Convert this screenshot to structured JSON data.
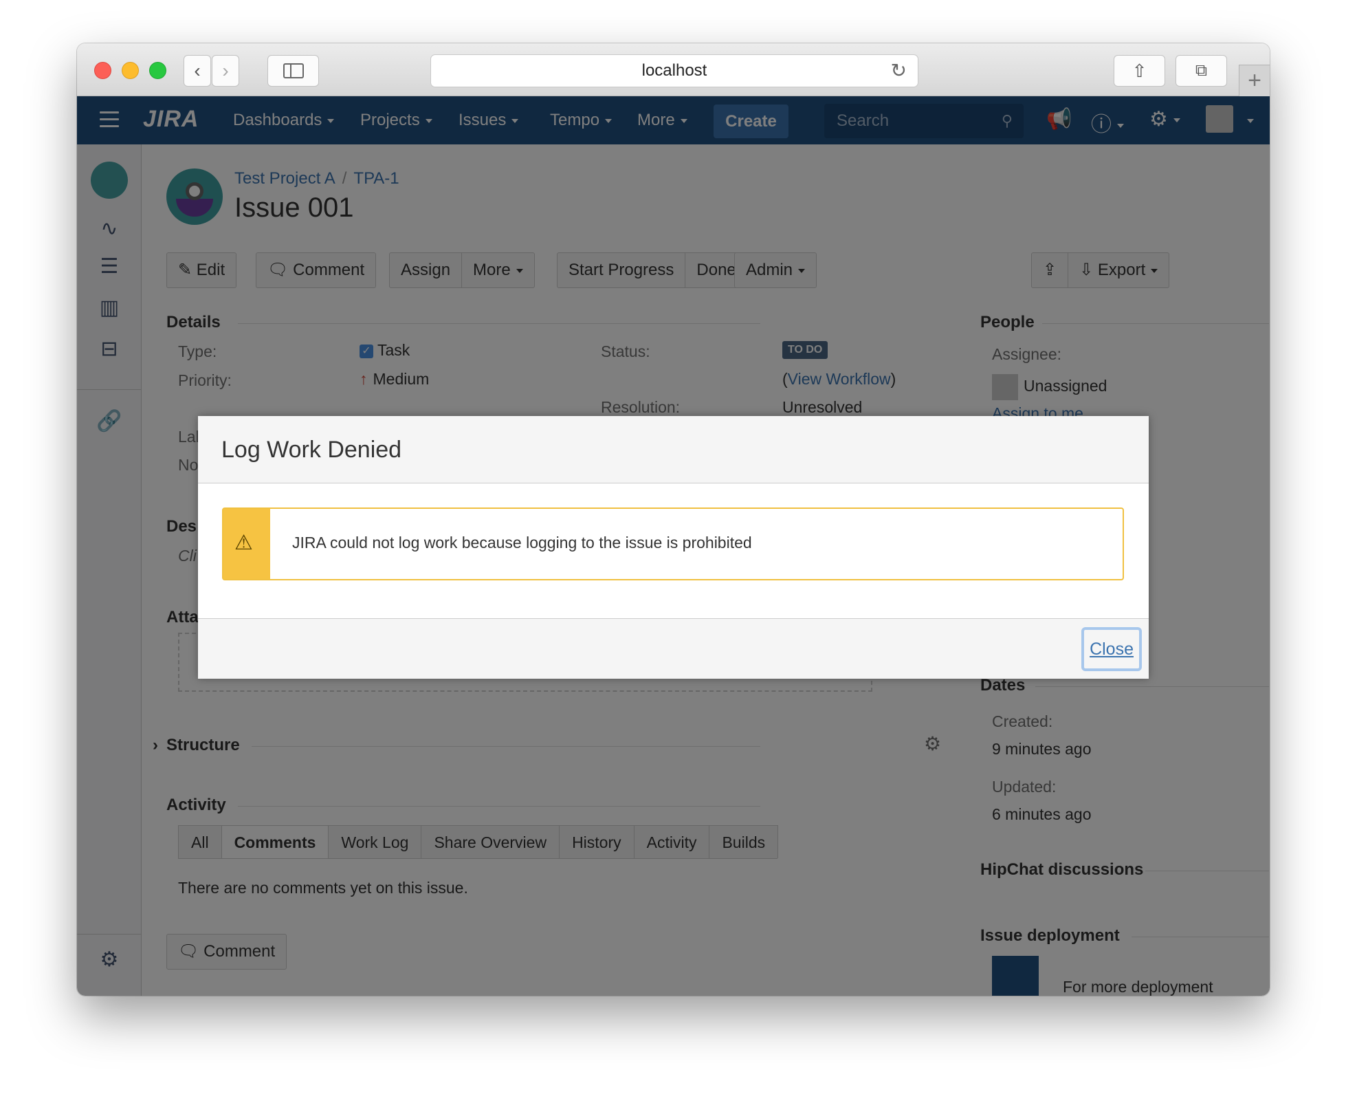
{
  "browser": {
    "url": "localhost"
  },
  "nav": {
    "logo": "JIRA",
    "items": [
      "Dashboards",
      "Projects",
      "Issues",
      "Tempo",
      "More"
    ],
    "create": "Create",
    "search_placeholder": "Search"
  },
  "issue": {
    "project": "Test Project A",
    "key": "TPA-1",
    "title": "Issue 001"
  },
  "toolbar": {
    "edit": "Edit",
    "comment": "Comment",
    "assign": "Assign",
    "more": "More",
    "start_progress": "Start Progress",
    "done": "Done",
    "admin": "Admin",
    "export": "Export"
  },
  "details": {
    "heading": "Details",
    "type_label": "Type:",
    "type_value": "Task",
    "priority_label": "Priority:",
    "priority_value": "Medium",
    "status_label": "Status:",
    "status_value": "TO DO",
    "view_workflow": "View Workflow",
    "resolution_label": "Resolution:",
    "resolution_value": "Unresolved",
    "labels_partial": "Lal",
    "none_partial": "No"
  },
  "partial_sections": {
    "description": "Des",
    "description_text": "Cli",
    "attachments": "Atta"
  },
  "structure": {
    "heading": "Structure"
  },
  "activity": {
    "heading": "Activity",
    "tabs": [
      "All",
      "Comments",
      "Work Log",
      "Share Overview",
      "History",
      "Activity",
      "Builds"
    ],
    "active_tab": "Comments",
    "empty": "There are no comments yet on this issue.",
    "comment_button": "Comment"
  },
  "people": {
    "heading": "People",
    "assignee_label": "Assignee:",
    "assignee_value": "Unassigned",
    "assign_to_me": "Assign to me"
  },
  "dates": {
    "heading": "Dates",
    "created_label": "Created:",
    "created_value": "9 minutes ago",
    "updated_label": "Updated:",
    "updated_value": "6 minutes ago"
  },
  "hipchat": {
    "heading": "HipChat discussions"
  },
  "deployment": {
    "heading": "Issue deployment",
    "text": "For more deployment"
  },
  "dialog": {
    "title": "Log Work Denied",
    "message": "JIRA could not log work because logging to the issue is prohibited",
    "close": "Close"
  },
  "colors": {
    "header": "#205081",
    "warning": "#f6c342",
    "link": "#3b73af"
  }
}
